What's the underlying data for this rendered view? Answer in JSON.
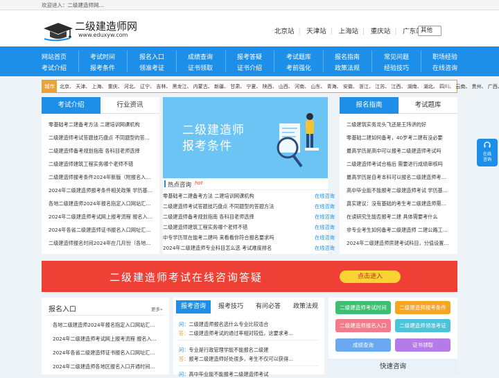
{
  "topbar": {
    "welcome": "欢迎进入：二级建造师网..."
  },
  "logo": {
    "title": "二级建造师网",
    "url": "www.eduxyw.com"
  },
  "stations": [
    "北京站",
    "天津站",
    "上海站",
    "重庆站",
    "广东站"
  ],
  "other_select": "其他",
  "nav": {
    "row1": [
      "网站首页",
      "考试时间",
      "报名入口",
      "成绩查询",
      "报考答疑",
      "考试题库",
      "报名指南",
      "常见问题",
      "职场经验"
    ],
    "row2": [
      "考试介绍",
      "报考条件",
      "领准考证",
      "证书领取",
      "证书介绍",
      "考前强化",
      "政策法规",
      "经验技巧",
      "在线咨询"
    ]
  },
  "city": {
    "label": "城市",
    "list": "北京、 天津、 上海、 重庆、 河北、 辽宁、 吉林、 黑龙江、 内蒙古、 新疆、 甘肃、 宁夏、 陕西、 山西、 河南、 山东、 青海、 安徽、 浙江、 江苏、 江西、 湖南、 湖北、 四川、 云南、 贵州、 广西、"
  },
  "left": {
    "tabs": [
      "考试介绍",
      "行业资讯"
    ],
    "items": [
      "零基础考二建备考方法 二建培训网课机构",
      "二级建造师考试答题技巧盘点 不同题型的答...",
      "二级建造师备考规划指南 各科目老师选择",
      "二级建造师建筑工程实务哪个老师不错",
      "二级建造师报考条件2024年新版（附报名入...",
      "2024年二级建造师报考条件相关政策 学历基...",
      "各地二级建造师2024年报名指定入口网站汇...",
      "2024年二级建造师考试网上报考流程 报名入...",
      "2024年各省二级建造师证书报名入口网址汇...",
      "二级建造师报名时间2024年在几月份（各地..."
    ]
  },
  "banner": {
    "line1": "二级建造师",
    "line2": "报考条件"
  },
  "hot": {
    "title": "热点咨询",
    "badge": "hot",
    "link": "在线咨询",
    "items": [
      "零基础考二建备考方法 二建培训网课机构",
      "二级建造师考试答题技巧盘点 不同题型的答题方法",
      "二级建造师备考规划指南 各科目老师选择",
      "二级建造师建筑工程实务哪个老师不错",
      "中专学历现在能考二建吗 来看看你符合报名要求吗",
      "2024年二级建造师专业科目怎么选 考试难度排名"
    ]
  },
  "right": {
    "tabs": [
      "报名指南",
      "考试题库"
    ],
    "items": [
      "二级建筑实务龙头飞还是王玮讲的好",
      "零基础二建如何备考，40岁考二建有没必要",
      "最高学历是高中可以报考二级建造师考试吗",
      "二级建造师考试合格后 需要进行成绩审核吗",
      "最高学历是自考本科可以报名二级建造师考...",
      "高中毕业能不能报考二级建造师考试 学历基...",
      "真实建议：没有基础的考生考二级建造师需...",
      "在读研究生能否报考二建 具体需要考什么",
      "非专业考生如何备考二级建造师 二建公路工...",
      "2024年二级建造师房建考试科目，分值设置..."
    ]
  },
  "ad": {
    "text": "二级建造师考试在线咨询答疑",
    "button": "点击进入"
  },
  "bottom_left": {
    "title": "报名入口",
    "more": "更多»",
    "items": [
      "各地二级建造师2024年报名指定入口网站汇...",
      "2024年二级建造师考试网上报考流程 报名入...",
      "2024年各省二级建造师证书报名入口网址汇...",
      "2024年二级建造师各地区报名入口开通时间..."
    ]
  },
  "bottom_mid": {
    "tabs": [
      "报考咨询",
      "报考技巧",
      "有问必答",
      "政策法规"
    ],
    "qa": [
      {
        "q": "二级建造师报名选什么专业比较适合",
        "a": "二级建造师考试的通过率相对较低，这要求考..."
      },
      {
        "q": "专业是行政管理学能不能报名二级建",
        "a": "报考二级建造师好处很多，考生不仅可以获得..."
      },
      {
        "q": "高中毕业能不能报考二级建造师考试",
        "a": ""
      }
    ],
    "q_label": "问：",
    "a_label": "答："
  },
  "bottom_right": {
    "buttons": [
      "二级建造师考试时间",
      "二级建造师报考条件",
      "二级建造师报名入口",
      "二级建造师领准考证",
      "成绩查询",
      "证书领取"
    ],
    "quick": "快速咨询"
  },
  "side": {
    "line1": "在线",
    "line2": "咨询"
  }
}
